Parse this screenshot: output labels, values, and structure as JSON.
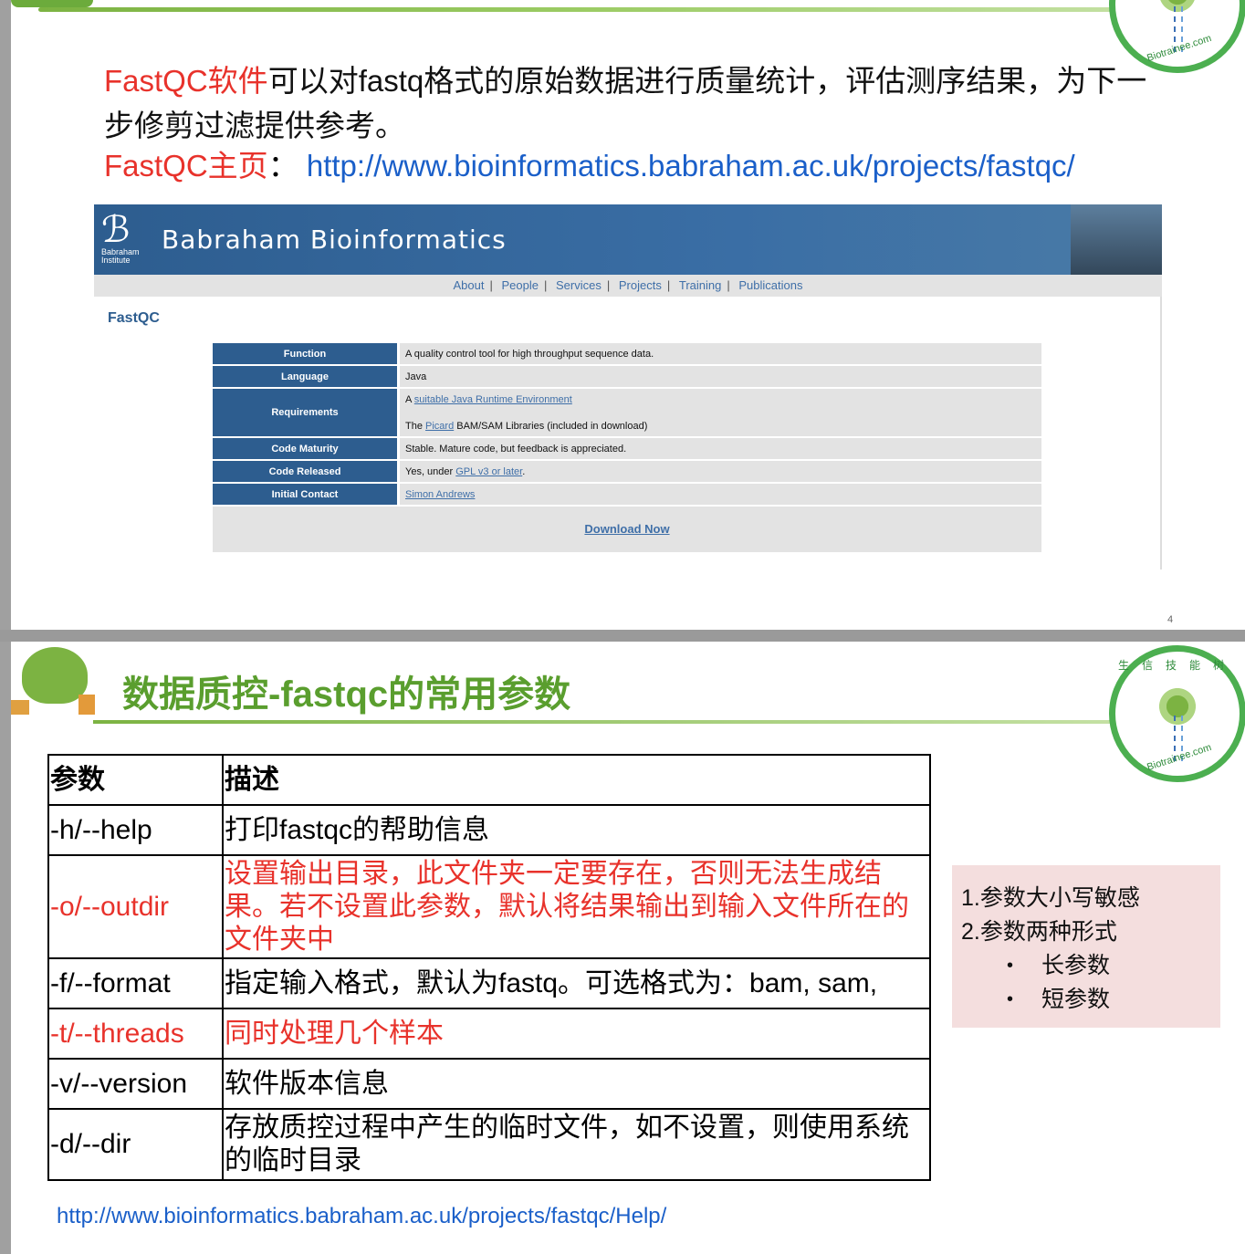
{
  "slide1": {
    "intro_red": "FastQC软件",
    "intro_rest": "可以对fastq格式的原始数据进行质量统计，评估测序结果，为下一步修剪过滤提供参考。",
    "homepage_label": "FastQC主页",
    "homepage_sep": "：",
    "homepage_url": "http://www.bioinformatics.babraham.ac.uk/projects/fastqc/",
    "logo_text": "Biotrainee.com",
    "page_number": "4",
    "site": {
      "logo_line1": "Babraham",
      "logo_line2": "Institute",
      "title": "Babraham Bioinformatics",
      "nav": [
        "About",
        "People",
        "Services",
        "Projects",
        "Training",
        "Publications"
      ],
      "nav_sep": "|",
      "heading": "FastQC",
      "rows": {
        "function": {
          "key": "Function",
          "value": "A quality control tool for high throughput sequence data."
        },
        "language": {
          "key": "Language",
          "value": "Java"
        },
        "requirements": {
          "key": "Requirements",
          "line1_prefix": "A ",
          "line1_link": "suitable Java Runtime Environment",
          "line2_prefix": "The ",
          "line2_link": "Picard",
          "line2_suffix": " BAM/SAM Libraries (included in download)"
        },
        "maturity": {
          "key": "Code Maturity",
          "value": "Stable. Mature code, but feedback is appreciated."
        },
        "released": {
          "key": "Code Released",
          "prefix": "Yes, under ",
          "link": "GPL v3 or later",
          "suffix": "."
        },
        "contact": {
          "key": "Initial Contact",
          "link": "Simon Andrews"
        }
      },
      "download": "Download Now"
    }
  },
  "slide2": {
    "title": "数据质控-fastqc的常用参数",
    "logo_cn": "生信技能树",
    "logo_text": "Biotrainee.com",
    "table": {
      "headers": [
        "参数",
        "描述"
      ],
      "rows": [
        {
          "param": "-h/--help",
          "desc": "打印fastqc的帮助信息"
        },
        {
          "param": "-o/--outdir",
          "desc": "设置输出目录，此文件夹一定要存在，否则无法生成结果。若不设置此参数，默认将结果输出到输入文件所在的文件夹中"
        },
        {
          "param": "-f/--format",
          "desc": "指定输入格式，默认为fastq。可选格式为：bam, sam,"
        },
        {
          "param": "-t/--threads",
          "desc": "同时处理几个样本"
        },
        {
          "param": "-v/--version",
          "desc": "软件版本信息"
        },
        {
          "param": "-d/--dir",
          "desc": "存放质控过程中产生的临时文件，如不设置，则使用系统的临时目录"
        }
      ]
    },
    "note": {
      "line1": "1.参数大小写敏感",
      "line2": "2.参数两种形式",
      "bullet1": "长参数",
      "bullet2": "短参数"
    },
    "help_url": "http://www.bioinformatics.babraham.ac.uk/projects/fastqc/Help/"
  },
  "colors": {
    "accent_red": "#e8322b",
    "link_blue": "#1a5fc9",
    "site_blue": "#2d5d8f",
    "title_green": "#5a9e2e",
    "note_bg": "#f4dede"
  }
}
